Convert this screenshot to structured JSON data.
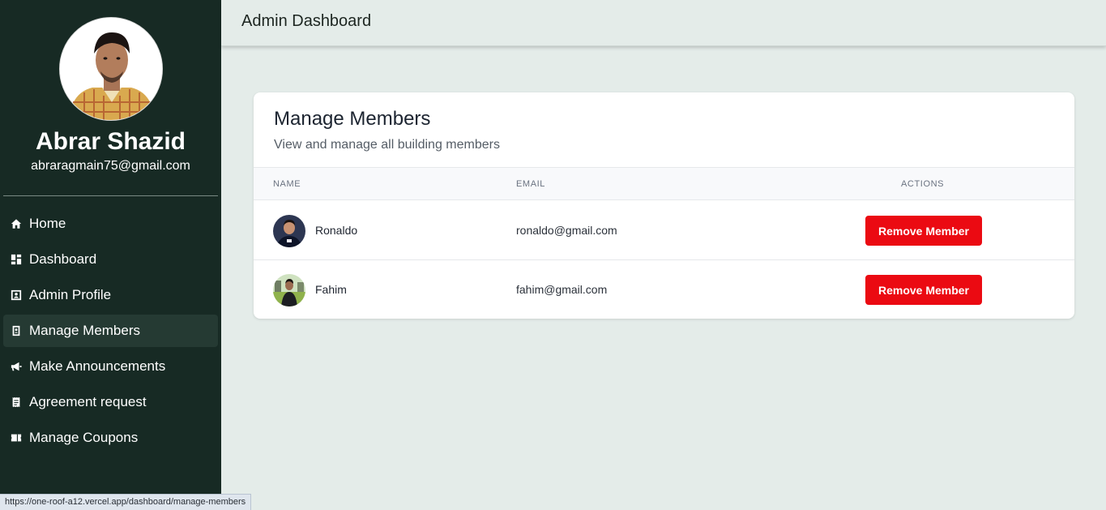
{
  "sidebar": {
    "profile": {
      "name": "Abrar Shazid",
      "email": "abraragmain75@gmail.com"
    },
    "nav": [
      {
        "label": "Home",
        "icon": "home-icon"
      },
      {
        "label": "Dashboard",
        "icon": "dashboard-icon"
      },
      {
        "label": "Admin Profile",
        "icon": "profile-icon"
      },
      {
        "label": "Manage Members",
        "icon": "members-icon",
        "active": true
      },
      {
        "label": "Make Announcements",
        "icon": "megaphone-icon"
      },
      {
        "label": "Agreement request",
        "icon": "receipt-icon"
      },
      {
        "label": "Manage Coupons",
        "icon": "coupon-icon"
      }
    ]
  },
  "header": {
    "title": "Admin Dashboard"
  },
  "main": {
    "title": "Manage Members",
    "subtitle": "View and manage all building members",
    "columns": [
      "NAME",
      "EMAIL",
      "ACTIONS"
    ],
    "members": [
      {
        "name": "Ronaldo",
        "email": "ronaldo@gmail.com",
        "action": "Remove Member"
      },
      {
        "name": "Fahim",
        "email": "fahim@gmail.com",
        "action": "Remove Member"
      }
    ]
  },
  "statusbar": {
    "url": "https://one-roof-a12.vercel.app/dashboard/manage-members"
  },
  "colors": {
    "sidebar_bg": "#172a24",
    "page_bg": "#e4ece9",
    "danger": "#eb0a12"
  }
}
